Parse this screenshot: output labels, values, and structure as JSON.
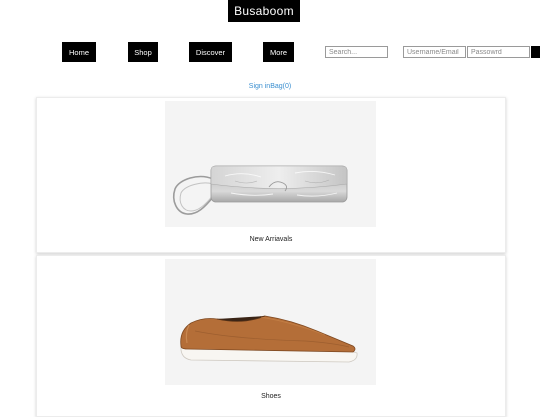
{
  "brand": {
    "name": "Busaboom"
  },
  "nav": {
    "items": [
      {
        "label": "Home"
      },
      {
        "label": "Shop"
      },
      {
        "label": "Discover"
      },
      {
        "label": "More"
      }
    ]
  },
  "search": {
    "placeholder": "Search..."
  },
  "login": {
    "username_placeholder": "Username/Email",
    "password_placeholder": "Passowrd"
  },
  "account": {
    "sign_in": "Sign in",
    "bag": "Bag(0)"
  },
  "products": [
    {
      "label": "New Arriavals",
      "icon": "silver-clutch-bag-image"
    },
    {
      "label": "Shoes",
      "icon": "brown-slip-on-shoe-image"
    }
  ],
  "colors": {
    "header_black": "#000000",
    "link_blue": "#3a8fd0",
    "image_background": "#f4f4f4"
  }
}
